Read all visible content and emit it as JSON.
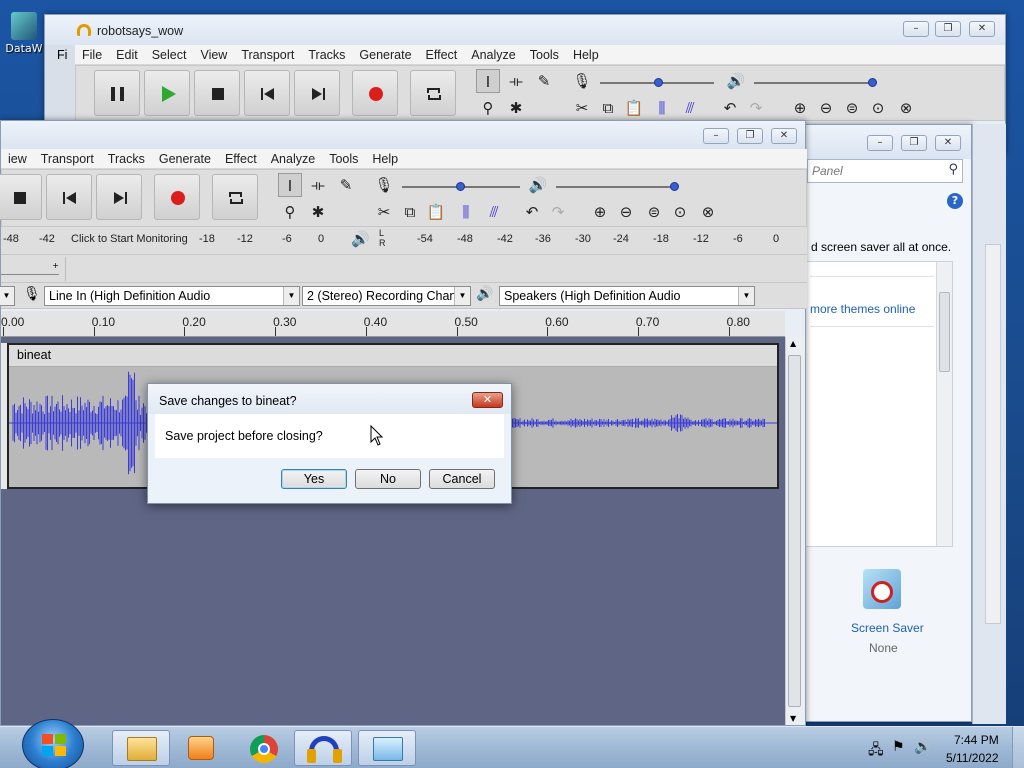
{
  "desktop": {
    "icon_label": "DataW"
  },
  "back_window": {
    "title": "robotsays_wow",
    "menu": [
      "File",
      "Edit",
      "Select",
      "View",
      "Transport",
      "Tracks",
      "Generate",
      "Effect",
      "Analyze",
      "Tools",
      "Help"
    ],
    "clipped_menu_start": "Fi"
  },
  "main_window": {
    "menu": [
      "iew",
      "Transport",
      "Tracks",
      "Generate",
      "Effect",
      "Analyze",
      "Tools",
      "Help"
    ],
    "meter_record_ticks": [
      "-48",
      "-42"
    ],
    "meter_monitor_text": "Click to Start Monitoring",
    "meter_record_ticks2": [
      "-18",
      "-12",
      "-6",
      "0"
    ],
    "meter_play_ticks": [
      "-54",
      "-48",
      "-42",
      "-36",
      "-30",
      "-24",
      "-18",
      "-12",
      "-6",
      "0"
    ],
    "device": {
      "input": "Line In (High Definition Audio",
      "channels": "2 (Stereo) Recording Chann",
      "output": "Speakers (High Definition Audio"
    },
    "timeline": [
      "0.00",
      "0.10",
      "0.20",
      "0.30",
      "0.40",
      "0.50",
      "0.60",
      "0.70",
      "0.80"
    ],
    "track_name": "bineat"
  },
  "control_panel": {
    "search_placeholder": "Panel",
    "text_line": "d screen saver all at once.",
    "link_more_themes": "more themes online",
    "screen_saver_label": "Screen Saver",
    "screen_saver_value": "None"
  },
  "dialog": {
    "title": "Save changes to bineat?",
    "message": "Save project before closing?",
    "yes": "Yes",
    "no": "No",
    "cancel": "Cancel"
  },
  "taskbar": {
    "time": "7:44 PM",
    "date": "5/11/2022"
  },
  "colors": {
    "waveform": "#3b3bd6",
    "track_bg": "#b9b9b9",
    "workspace": "#5f6585"
  }
}
